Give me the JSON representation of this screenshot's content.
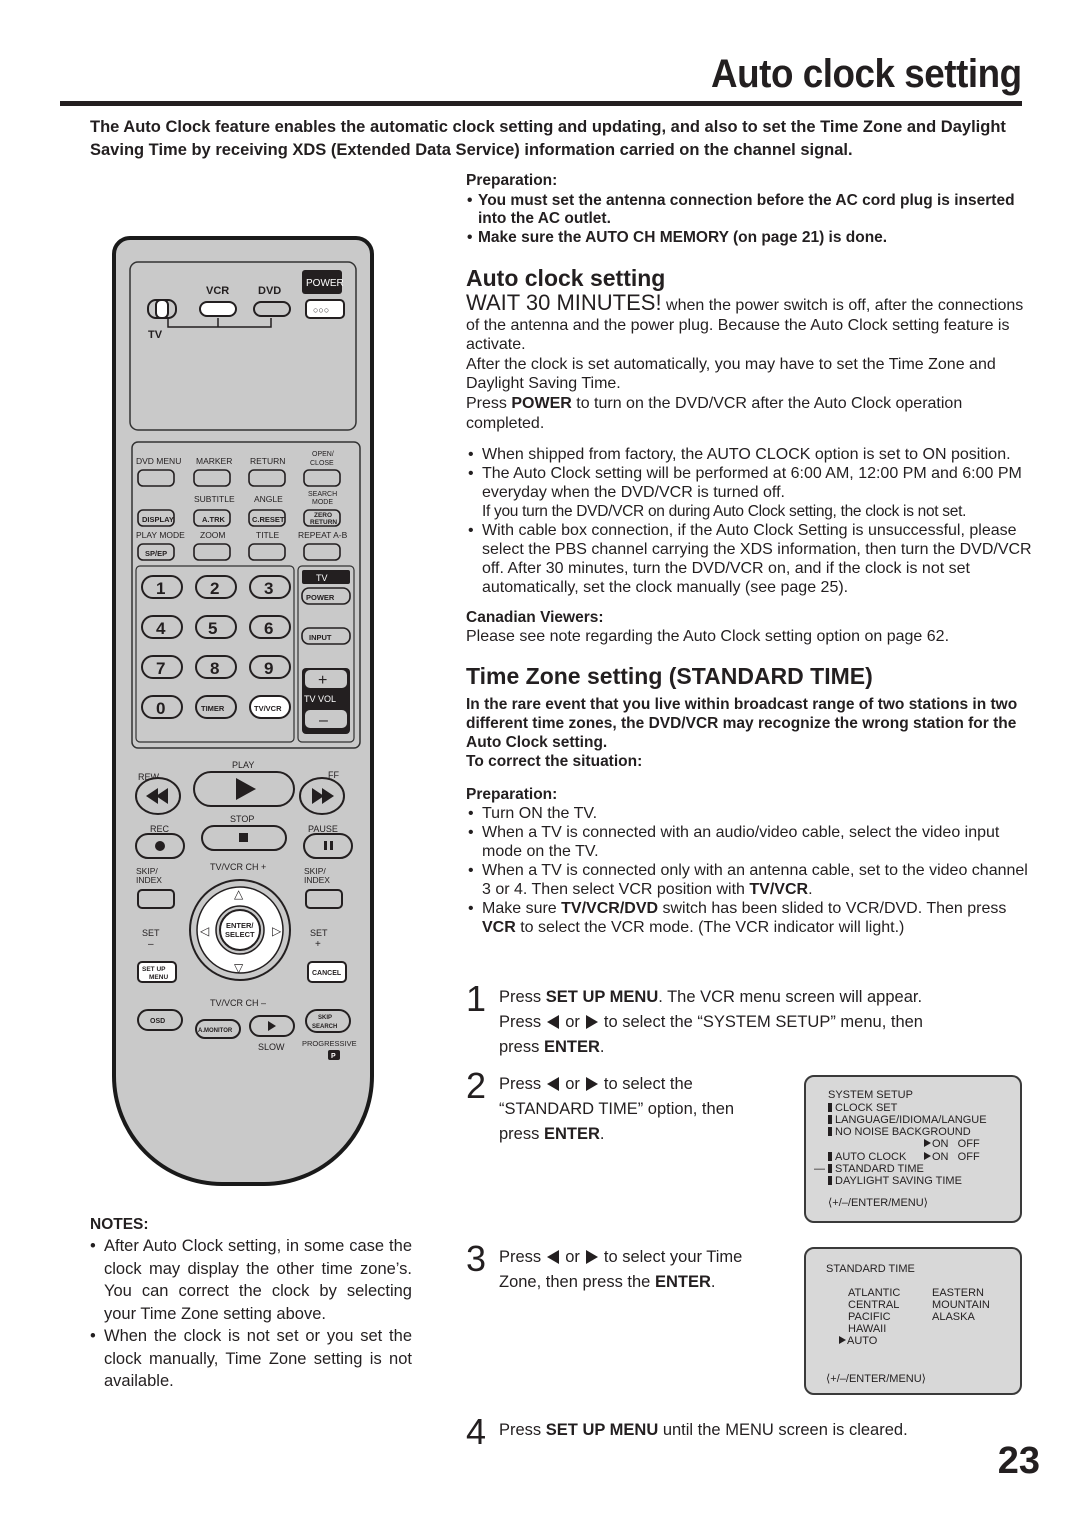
{
  "page": {
    "title": "Auto clock setting",
    "page_number": "23",
    "intro": "The Auto Clock feature enables the automatic clock setting and updating, and also to set the Time Zone and Daylight Saving Time by receiving XDS (Extended Data Service) information carried on the channel signal."
  },
  "preparation1": {
    "title": "Preparation:",
    "items": [
      "You must set the antenna connection before the AC cord plug is inserted into the AC outlet.",
      "Make sure the AUTO CH MEMORY (on page 21) is done."
    ]
  },
  "auto_clock": {
    "heading": "Auto clock setting",
    "wait": "WAIT 30 MINUTES!",
    "wait_rest": " when the power switch is off, after the connections of the antenna and the power plug. Because the Auto Clock setting feature is activate.",
    "after": "After the clock is set automatically, you may have to set the Time Zone and Daylight Saving Time.",
    "press_pre": "Press ",
    "press_key": "POWER",
    "press_post": " to turn on the DVD/VCR after the Auto Clock operation completed.",
    "bullets": [
      "When shipped from factory, the AUTO CLOCK option is set to ON position.",
      "The Auto Clock setting will be performed at 6:00 AM, 12:00 PM and 6:00 PM everyday when the DVD/VCR is turned off.",
      "With cable box connection, if the Auto Clock Setting is unsuccessful, please select the PBS channel carrying the XDS information, then turn the DVD/VCR off. After 30 minutes, turn the DVD/VCR on, and if the clock is not set automatically, set the clock manually (see page 25)."
    ],
    "sub_note": "If you turn the DVD/VCR on during Auto Clock setting, the clock is not set.",
    "canadian_title": "Canadian Viewers:",
    "canadian_text": "Please see note regarding the Auto Clock setting option on page 62."
  },
  "time_zone": {
    "heading": "Time Zone setting (STANDARD TIME)",
    "intro": "In the rare event that you live within broadcast range of two stations in two different time zones, the DVD/VCR may recognize the wrong station for the Auto Clock setting.",
    "correct": "To correct the situation:",
    "prep_title": "Preparation:",
    "prep_items": {
      "i0": "Turn ON the TV.",
      "i1": "When a TV is connected with an audio/video cable, select the video input mode on the TV.",
      "i2_pre": "When a TV is connected only with an antenna cable, set to the video channel 3 or 4. Then select VCR position with ",
      "i2_key": "TV/VCR",
      "i2_post": ".",
      "i3_pre": "Make sure ",
      "i3_key": "TV/VCR/DVD",
      "i3_mid": " switch has been slided to VCR/DVD. Then press ",
      "i3_key2": "VCR",
      "i3_post": " to select the VCR mode. (The VCR indicator will light.)"
    }
  },
  "steps": [
    {
      "num": "1",
      "a": "Press ",
      "b": "SET UP MENU",
      "c": ". The VCR menu screen will appear.",
      "d": "Press",
      "or": "or",
      "e": "to select the “SYSTEM SETUP” menu, then",
      "f": "press ",
      "g": "ENTER",
      "h": "."
    },
    {
      "num": "2",
      "d": "Press",
      "or": "or",
      "e": "to select the",
      "l2": "“STANDARD TIME” option, then",
      "f": "press ",
      "g": "ENTER",
      "h": "."
    },
    {
      "num": "3",
      "d": "Press",
      "or": "or",
      "e": "to select your Time",
      "l2": "Zone, then press the ",
      "g": "ENTER",
      "h": "."
    },
    {
      "num": "4",
      "a": "Press ",
      "b": "SET UP MENU",
      "c": " until the MENU screen is cleared."
    }
  ],
  "osd_system_setup": {
    "title": "SYSTEM SETUP",
    "items": [
      "CLOCK SET",
      "LANGUAGE/IDIOMA/LANGUE",
      "NO NOISE BACKGROUND",
      "AUTO CLOCK",
      "STANDARD TIME",
      "DAYLIGHT SAVING TIME"
    ],
    "on": "ON",
    "off": "OFF",
    "footer": "⟨+/–/ENTER/MENU⟩"
  },
  "osd_standard_time": {
    "title": "STANDARD TIME",
    "col1": [
      "ATLANTIC",
      "CENTRAL",
      "PACIFIC",
      "HAWAII",
      "AUTO"
    ],
    "col2": [
      "EASTERN",
      "MOUNTAIN",
      "ALASKA"
    ],
    "selected": "AUTO",
    "footer": "⟨+/–/ENTER/MENU⟩"
  },
  "notes": {
    "title": "NOTES:",
    "items": [
      "After Auto Clock setting, in some case the clock may display the other time zone’s. You can correct the clock by selecting your Time Zone setting above.",
      "When the clock is not set or you set the clock manually, Time Zone setting is not available."
    ]
  },
  "remote": {
    "vcr": "VCR",
    "dvd": "DVD",
    "power": "POWER",
    "tv": "TV",
    "row1": [
      "DVD MENU",
      "MARKER",
      "RETURN",
      "OPEN/",
      "CLOSE"
    ],
    "row2": [
      "SUBTITLE",
      "ANGLE",
      "SEARCH",
      "MODE"
    ],
    "row2_btns": [
      "DISPLAY",
      "A.TRK",
      "C.RESET",
      "ZERO",
      "RETURN"
    ],
    "row3": [
      "PLAY MODE",
      "ZOOM",
      "TITLE",
      "REPEAT A-B"
    ],
    "sp_ep": "SP/EP",
    "digits": [
      "1",
      "2",
      "3",
      "4",
      "5",
      "6",
      "7",
      "8",
      "9",
      "0"
    ],
    "timer": "TIMER",
    "tv_vcr": "TV/VCR",
    "tv_label": "TV",
    "tv_power": "POWER",
    "input": "INPUT",
    "tv_vol": "TV VOL",
    "play": "PLAY",
    "rew": "REW",
    "ff": "FF",
    "stop": "STOP",
    "rec": "REC",
    "pause": "PAUSE",
    "ch_plus": "TV/VCR CH +",
    "ch_minus": "TV/VCR CH –",
    "skip": "SKIP/",
    "index": "INDEX",
    "set": "SET",
    "enter": "ENTER/",
    "select": "SELECT",
    "setup": "SET UP",
    "menu": "MENU",
    "cancel": "CANCEL",
    "osd": "OSD",
    "amonitor": "A.MONITOR",
    "slow": "SLOW",
    "skip_search1": "SKIP",
    "skip_search2": "SEARCH",
    "progressive": "PROGRESSIVE",
    "p": "P"
  }
}
